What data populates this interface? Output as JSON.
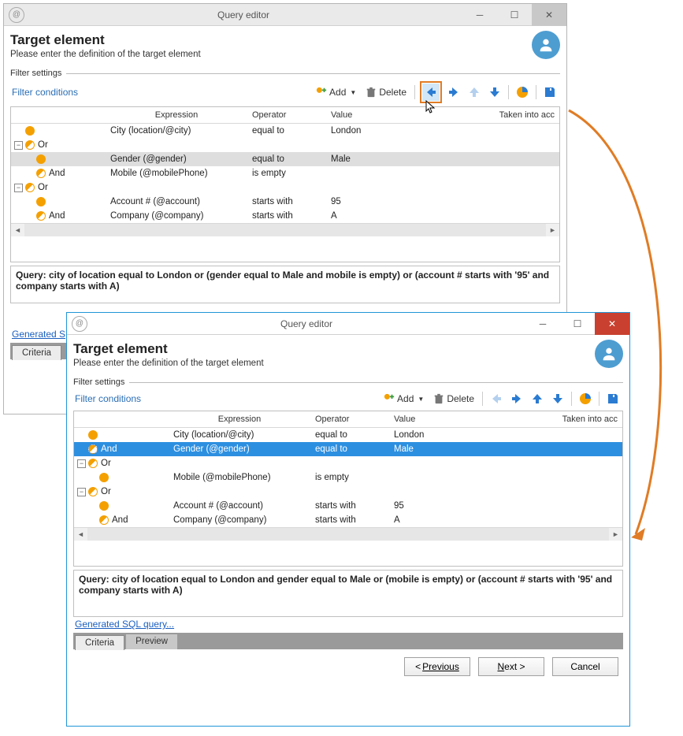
{
  "windows": {
    "back": {
      "title": "Query editor",
      "target_heading": "Target element",
      "target_sub": "Please enter the definition of the target element",
      "filter_settings_label": "Filter settings",
      "filter_conditions_label": "Filter conditions",
      "toolbar": {
        "add_label": "Add",
        "delete_label": "Delete"
      },
      "grid_headers": {
        "expression": "Expression",
        "operator": "Operator",
        "value": "Value",
        "taken": "Taken into acc"
      },
      "rows": [
        {
          "indent": 0,
          "icon": "full",
          "op_label": "",
          "expression": "City (location/@city)",
          "operator": "equal to",
          "value": "London"
        },
        {
          "indent": 0,
          "expander": true,
          "icon": "half",
          "op_label": "Or"
        },
        {
          "indent": 1,
          "icon": "full",
          "op_label": "",
          "expression": "Gender (@gender)",
          "operator": "equal to",
          "value": "Male",
          "selected_gray": true
        },
        {
          "indent": 1,
          "icon": "half",
          "op_label": "And",
          "expression": "Mobile (@mobilePhone)",
          "operator": "is empty",
          "value": ""
        },
        {
          "indent": 0,
          "expander": true,
          "icon": "half",
          "op_label": "Or"
        },
        {
          "indent": 1,
          "icon": "full",
          "op_label": "",
          "expression": "Account # (@account)",
          "operator": "starts with",
          "value": "95"
        },
        {
          "indent": 1,
          "icon": "half",
          "op_label": "And",
          "expression": "Company (@company)",
          "operator": "starts with",
          "value": "A"
        }
      ],
      "query_summary": "Query: city of location equal to London or (gender equal to Male and mobile is empty) or (account # starts with '95' and company starts with A)",
      "gen_sql_label": "Generated S",
      "tabs": {
        "criteria": "Criteria"
      }
    },
    "front": {
      "title": "Query editor",
      "target_heading": "Target element",
      "target_sub": "Please enter the definition of the target element",
      "filter_settings_label": "Filter settings",
      "filter_conditions_label": "Filter conditions",
      "toolbar": {
        "add_label": "Add",
        "delete_label": "Delete"
      },
      "grid_headers": {
        "expression": "Expression",
        "operator": "Operator",
        "value": "Value",
        "taken": "Taken into acc"
      },
      "rows": [
        {
          "indent": 0,
          "icon": "full",
          "op_label": "",
          "expression": "City (location/@city)",
          "operator": "equal to",
          "value": "London"
        },
        {
          "indent": 0,
          "icon": "half-dotted",
          "op_label": "And",
          "expression": "Gender (@gender)",
          "operator": "equal to",
          "value": "Male",
          "selected_blue": true
        },
        {
          "indent": 0,
          "expander": true,
          "icon": "half",
          "op_label": "Or"
        },
        {
          "indent": 1,
          "icon": "full",
          "op_label": "",
          "expression": "Mobile (@mobilePhone)",
          "operator": "is empty",
          "value": ""
        },
        {
          "indent": 0,
          "expander": true,
          "icon": "half",
          "op_label": "Or"
        },
        {
          "indent": 1,
          "icon": "full",
          "op_label": "",
          "expression": "Account # (@account)",
          "operator": "starts with",
          "value": "95"
        },
        {
          "indent": 1,
          "icon": "half",
          "op_label": "And",
          "expression": "Company (@company)",
          "operator": "starts with",
          "value": "A"
        }
      ],
      "query_summary": "Query: city of location equal to London and gender equal to Male or (mobile is empty) or (account # starts with '95' and company starts with A)",
      "gen_sql_label": "Generated SQL query...",
      "tabs": {
        "criteria": "Criteria",
        "preview": "Preview"
      },
      "buttons": {
        "previous": "Previous",
        "next": "Next >",
        "cancel": "Cancel"
      }
    }
  },
  "colors": {
    "accent_blue": "#2d8fe0",
    "orange": "#e07c25",
    "icon_orange": "#f4a000"
  }
}
